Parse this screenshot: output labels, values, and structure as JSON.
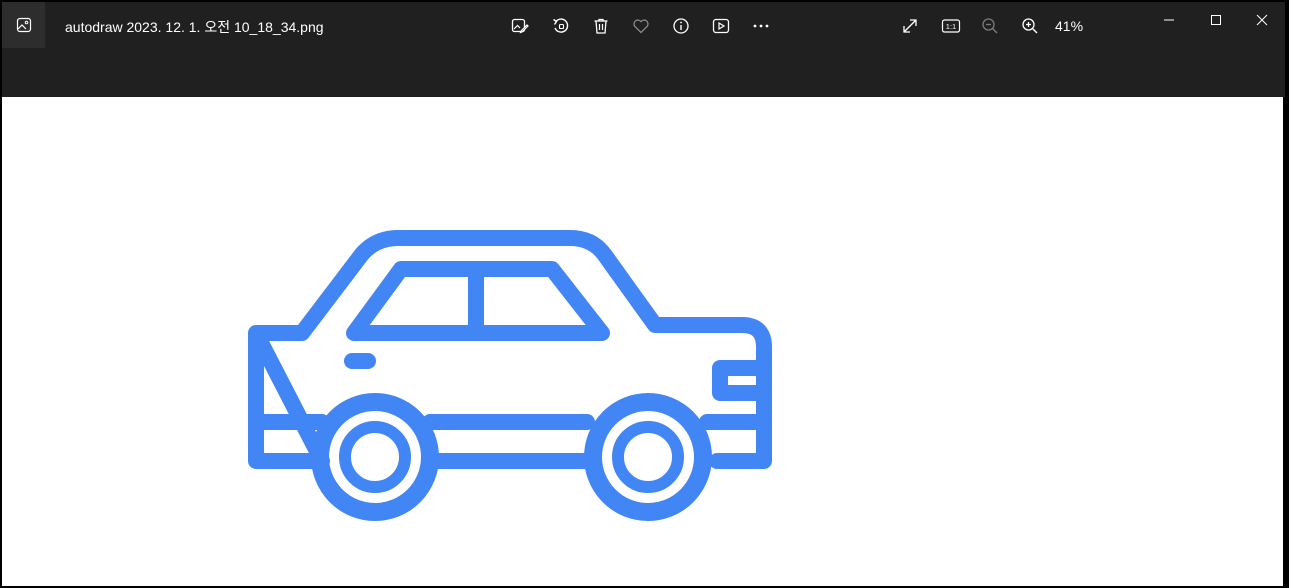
{
  "window": {
    "title": "autodraw 2023. 12. 1. 오전 10_18_34.png"
  },
  "toolbar": {
    "items": [
      {
        "name": "edit-image-icon",
        "label": ""
      },
      {
        "name": "rotate-icon",
        "label": ""
      },
      {
        "name": "delete-icon",
        "label": ""
      },
      {
        "name": "favorite-heart-icon",
        "label": ""
      },
      {
        "name": "info-icon",
        "label": ""
      },
      {
        "name": "slideshow-icon",
        "label": ""
      },
      {
        "name": "more-options-icon",
        "label": ""
      }
    ],
    "view": {
      "actual_size_label": "1:1",
      "zoom_percent": "41%"
    }
  },
  "image": {
    "subject_icon": "car-outline-icon",
    "stroke_color": "#4285f4",
    "background_color": "#ffffff"
  },
  "colors": {
    "titlebar_bg": "#202020",
    "accent": "#4285f4"
  }
}
